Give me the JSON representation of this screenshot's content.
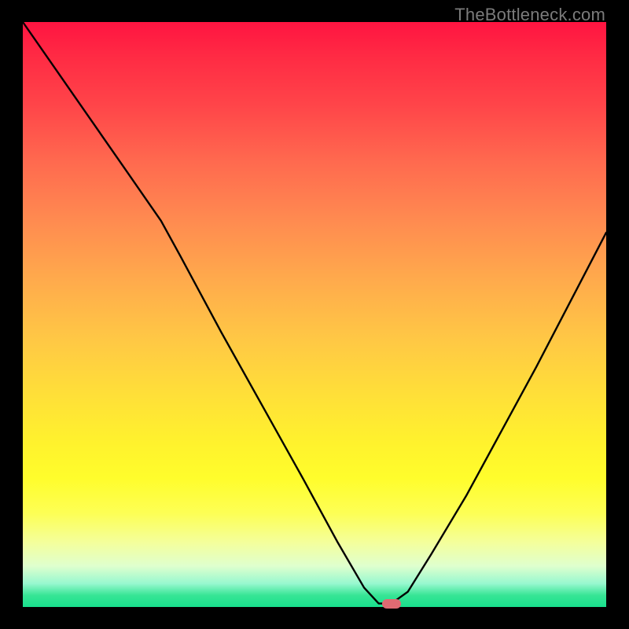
{
  "watermark": "TheBottleneck.com",
  "marker": {
    "cx_frac": 0.632,
    "cy_frac": 0.994
  },
  "chart_data": {
    "type": "line",
    "title": "",
    "xlabel": "",
    "ylabel": "",
    "xlim": [
      0,
      100
    ],
    "ylim": [
      0,
      100
    ],
    "x": [
      0,
      6,
      12,
      18,
      23.7,
      27,
      34,
      41,
      48,
      54,
      58.5,
      61,
      63.2,
      66,
      70,
      76,
      82,
      88,
      94,
      100
    ],
    "values": [
      100,
      91.4,
      82.8,
      74.2,
      66,
      60,
      47,
      34.5,
      22,
      11,
      3.3,
      0.6,
      0.6,
      2.6,
      9,
      19,
      30,
      41,
      52.5,
      64
    ],
    "annotations": [
      {
        "type": "marker",
        "x": 63.2,
        "y": 0.6,
        "shape": "pill",
        "color": "#e06a72"
      }
    ]
  }
}
